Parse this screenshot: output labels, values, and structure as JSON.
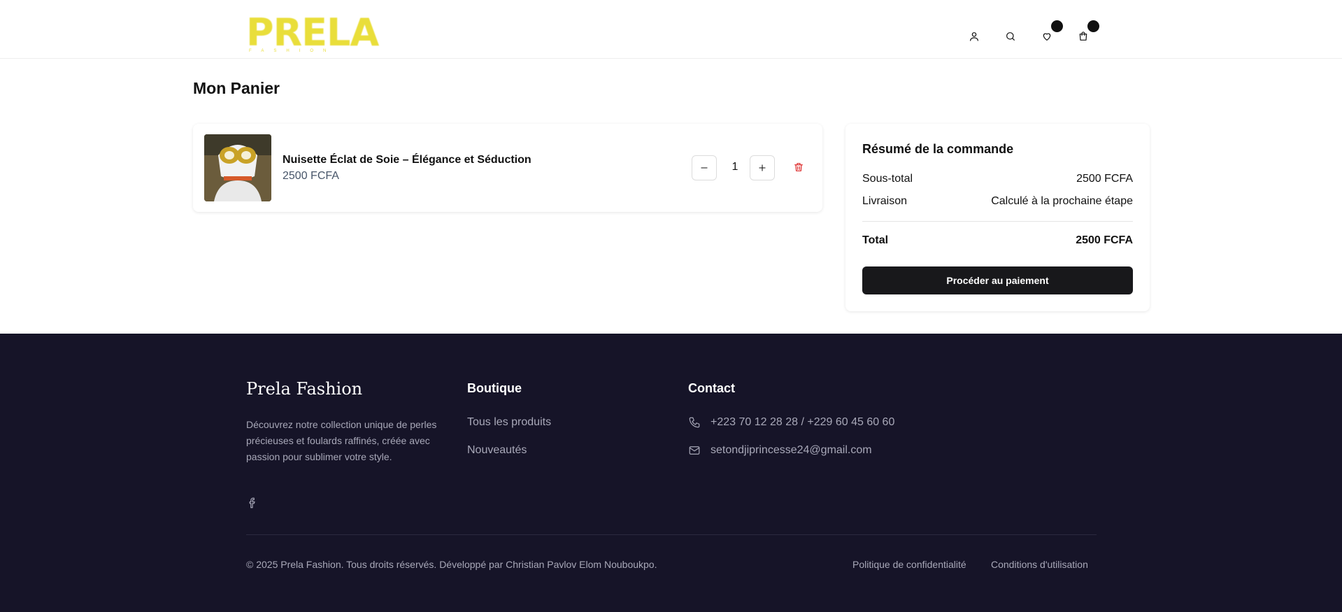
{
  "header": {
    "logo_text": "PRELA",
    "logo_sub": "FASHION",
    "icons": [
      "user-icon",
      "search-icon",
      "heart-icon",
      "shopping-bag-icon"
    ],
    "wishlist_count": "",
    "cart_count": ""
  },
  "page": {
    "title": "Mon Panier"
  },
  "cart": {
    "items": [
      {
        "name": "Nuisette Éclat de Soie – Élégance et Séduction",
        "price": "2500 FCFA",
        "quantity": "1"
      }
    ]
  },
  "summary": {
    "title": "Résumé de la commande",
    "subtotal_label": "Sous-total",
    "subtotal_value": "2500 FCFA",
    "shipping_label": "Livraison",
    "shipping_value": "Calculé à la prochaine étape",
    "total_label": "Total",
    "total_value": "2500 FCFA",
    "checkout_label": "Procéder au paiement"
  },
  "footer": {
    "brand": "Prela Fashion",
    "description": "Découvrez notre collection unique de perles précieuses et foulards raffinés, créée avec passion pour sublimer votre style.",
    "shop_title": "Boutique",
    "shop_links": [
      "Tous les produits",
      "Nouveautés"
    ],
    "contact_title": "Contact",
    "phone": "+223 70 12 28 28 / +229 60 45 60 60",
    "email": "setondjiprincesse24@gmail.com",
    "copyright": "© 2025 Prela Fashion. Tous droits réservés. Développé par Christian Pavlov Elom Nouboukpo.",
    "privacy": "Politique de confidentialité",
    "terms": "Conditions d'utilisation"
  },
  "colors": {
    "accent": "#e9de3a",
    "footer_bg": "#161428",
    "danger": "#dc2626",
    "button": "#18181b"
  }
}
